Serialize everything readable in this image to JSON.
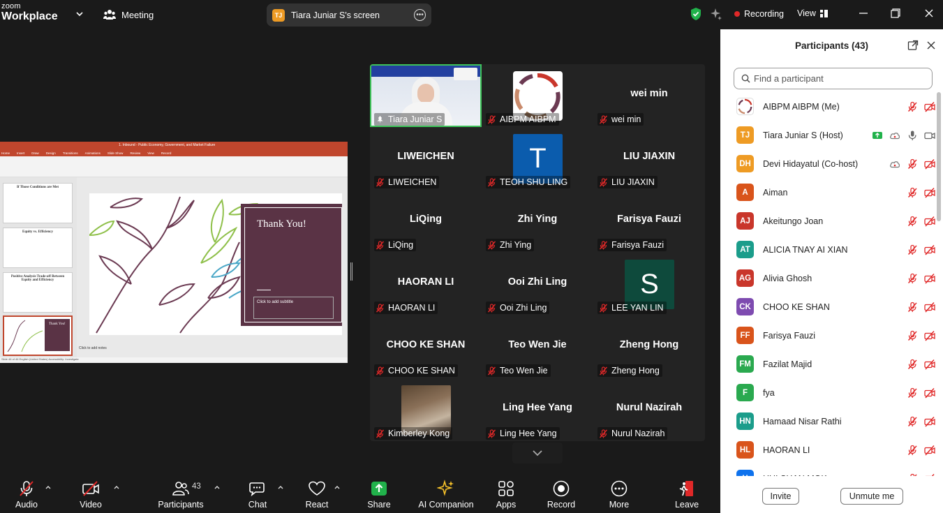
{
  "topbar": {
    "brand_line1": "zoom",
    "brand_line2": "Workplace",
    "meeting_label": "Meeting",
    "screen_initials": "TJ",
    "screen_label": "Tiara Juniar S's screen",
    "recording_label": "Recording",
    "view_label": "View"
  },
  "shared_screen": {
    "window_title": "1. Inbound - Public Economy, Government, and Market Failure",
    "tabs": [
      "Home",
      "Insert",
      "Draw",
      "Design",
      "Transitions",
      "Animations",
      "Slide Show",
      "Review",
      "View",
      "Record"
    ],
    "thumbs": [
      {
        "title": "If Those Conditions are Met"
      },
      {
        "title": "Equity vs. Efficiency"
      },
      {
        "title": "Positive Analysis Trade-off Between Equity and Efficiency"
      },
      {
        "title": "Thank You!"
      }
    ],
    "slide_title": "Thank You!",
    "slide_subtitle_placeholder": "Click to add subtitle",
    "notes_placeholder": "Click to add notes",
    "status_text": "Slide 46 of 46    English (United States)    Accessibility: Investigate"
  },
  "gallery": {
    "tiles": [
      {
        "name": "Tiara Juniar S",
        "label": "Tiara Juniar S",
        "kind": "video"
      },
      {
        "name": "AIBPM AIBPM",
        "label": "AIBPM AIBPM",
        "kind": "logo"
      },
      {
        "name": "wei min",
        "label": "wei min",
        "kind": "name"
      },
      {
        "name": "LIWEICHEN",
        "label": "LIWEICHEN",
        "kind": "name"
      },
      {
        "name": "TEOH SHU LING",
        "label": "TEOH SHU LING",
        "kind": "letter",
        "letter": "T",
        "color": "#0b5cad"
      },
      {
        "name": "LIU JIAXIN",
        "label": "LIU JIAXIN",
        "kind": "name"
      },
      {
        "name": "LiQing",
        "label": "LiQing",
        "kind": "name"
      },
      {
        "name": "Zhi Ying",
        "label": "Zhi Ying",
        "kind": "name"
      },
      {
        "name": "Farisya Fauzi",
        "label": "Farisya Fauzi",
        "kind": "name"
      },
      {
        "name": "HAORAN LI",
        "label": "HAORAN LI",
        "kind": "name"
      },
      {
        "name": "Ooi Zhi Ling",
        "label": "Ooi Zhi Ling",
        "kind": "name"
      },
      {
        "name": "LEE YAN LIN",
        "label": "LEE YAN LIN",
        "kind": "letter",
        "letter": "S",
        "color": "#0e4a3c"
      },
      {
        "name": "CHOO KE SHAN",
        "label": "CHOO KE SHAN",
        "kind": "name"
      },
      {
        "name": "Teo Wen Jie",
        "label": "Teo Wen Jie",
        "kind": "name"
      },
      {
        "name": "Zheng Hong",
        "label": "Zheng Hong",
        "kind": "name"
      },
      {
        "name": "Kimberley Kong",
        "label": "Kimberley Kong",
        "kind": "photo"
      },
      {
        "name": "Ling Hee Yang",
        "label": "Ling Hee Yang",
        "kind": "name"
      },
      {
        "name": "Nurul Nazirah",
        "label": "Nurul Nazirah",
        "kind": "name"
      }
    ]
  },
  "panel": {
    "title": "Participants (43)",
    "search_placeholder": "Find a participant",
    "invite_label": "Invite",
    "unmute_label": "Unmute me",
    "participants": [
      {
        "initials": "",
        "name": "AIBPM AIBPM (Me)",
        "color": "logo",
        "icons": [
          "mic-muted",
          "video-off"
        ]
      },
      {
        "initials": "TJ",
        "name": "Tiara Juniar S (Host)",
        "color": "#ee9b24",
        "icons": [
          "share",
          "cloud",
          "mic",
          "video"
        ]
      },
      {
        "initials": "DH",
        "name": "Devi Hidayatul (Co-host)",
        "color": "#ee9b24",
        "icons": [
          "cloud",
          "mic-muted",
          "video-off"
        ]
      },
      {
        "initials": "A",
        "name": "Aiman",
        "color": "#d9541b",
        "icons": [
          "mic-muted",
          "video-off"
        ]
      },
      {
        "initials": "AJ",
        "name": "Akeitungo Joan",
        "color": "#c9362b",
        "icons": [
          "mic-muted",
          "video-off"
        ]
      },
      {
        "initials": "AT",
        "name": "ALICIA TNAY AI XIAN",
        "color": "#1b9d8b",
        "icons": [
          "mic-muted",
          "video-off"
        ]
      },
      {
        "initials": "AG",
        "name": "Alivia Ghosh",
        "color": "#c9362b",
        "icons": [
          "mic-muted",
          "video-off"
        ]
      },
      {
        "initials": "CK",
        "name": "CHOO KE SHAN",
        "color": "#7e4bb0",
        "icons": [
          "mic-muted",
          "video-off"
        ]
      },
      {
        "initials": "FF",
        "name": "Farisya Fauzi",
        "color": "#d9541b",
        "icons": [
          "mic-muted",
          "video-off"
        ]
      },
      {
        "initials": "FM",
        "name": "Fazilat Majid",
        "color": "#2aa94f",
        "icons": [
          "mic-muted",
          "video-off"
        ]
      },
      {
        "initials": "F",
        "name": "fya",
        "color": "#2aa94f",
        "icons": [
          "mic-muted",
          "video-off"
        ]
      },
      {
        "initials": "HN",
        "name": "Hamaad Nisar Rathi",
        "color": "#1b9d8b",
        "icons": [
          "mic-muted",
          "video-off"
        ]
      },
      {
        "initials": "HL",
        "name": "HAORAN LI",
        "color": "#d9541b",
        "icons": [
          "mic-muted",
          "video-off"
        ]
      },
      {
        "initials": "H",
        "name": "HUI SHAN MOK",
        "color": "#0e72ed",
        "icons": [
          "mic-muted",
          "video-off"
        ]
      }
    ]
  },
  "toolbar": {
    "audio_label": "Audio",
    "video_label": "Video",
    "participants_label": "Participants",
    "participants_count": "43",
    "chat_label": "Chat",
    "react_label": "React",
    "share_label": "Share",
    "ai_label": "AI Companion",
    "apps_label": "Apps",
    "record_label": "Record",
    "more_label": "More",
    "leave_label": "Leave"
  }
}
